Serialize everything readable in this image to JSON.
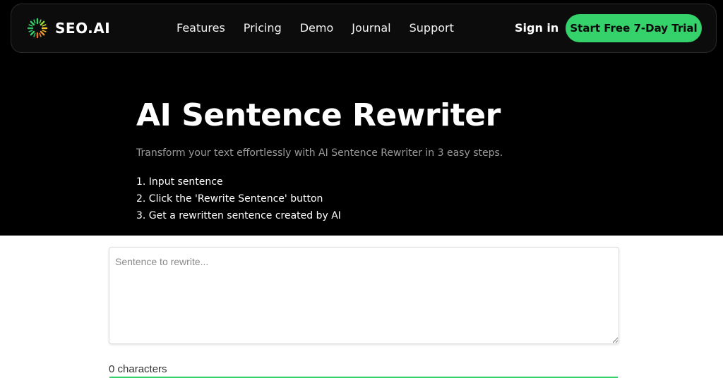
{
  "brand": {
    "name": "SEO.AI",
    "accent": "#35d16a"
  },
  "nav": {
    "links": [
      "Features",
      "Pricing",
      "Demo",
      "Journal",
      "Support"
    ],
    "signin": "Sign in",
    "cta": "Start Free 7-Day Trial"
  },
  "hero": {
    "title": "AI Sentence Rewriter",
    "subtitle": "Transform your text effortlessly with AI Sentence Rewriter in 3 easy steps.",
    "steps": [
      "1. Input sentence",
      "2. Click the 'Rewrite Sentence' button",
      "3. Get a rewritten sentence created by AI"
    ]
  },
  "editor": {
    "placeholder": "Sentence to rewrite...",
    "value": "",
    "char_count": "0 characters"
  }
}
